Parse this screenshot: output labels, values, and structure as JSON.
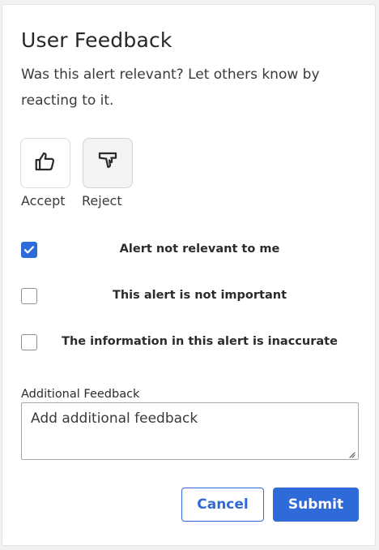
{
  "dialog": {
    "title": "User Feedback",
    "subtitle": "Was this alert relevant? Let others know by reacting to it."
  },
  "reactions": [
    {
      "label": "Accept",
      "icon": "thumbs-up-icon",
      "selected": false
    },
    {
      "label": "Reject",
      "icon": "thumbs-down-icon",
      "selected": true
    }
  ],
  "reasons": [
    {
      "label": "Alert not relevant to me",
      "checked": true
    },
    {
      "label": "This alert is not important",
      "checked": false
    },
    {
      "label": "The information in this alert is inaccurate",
      "checked": false
    }
  ],
  "additional_feedback": {
    "label": "Additional Feedback",
    "placeholder": "Add additional feedback",
    "value": ""
  },
  "actions": {
    "cancel_label": "Cancel",
    "submit_label": "Submit"
  },
  "colors": {
    "accent": "#2f6bd8",
    "text": "#2b2b2b",
    "border": "#dcdcdc"
  }
}
